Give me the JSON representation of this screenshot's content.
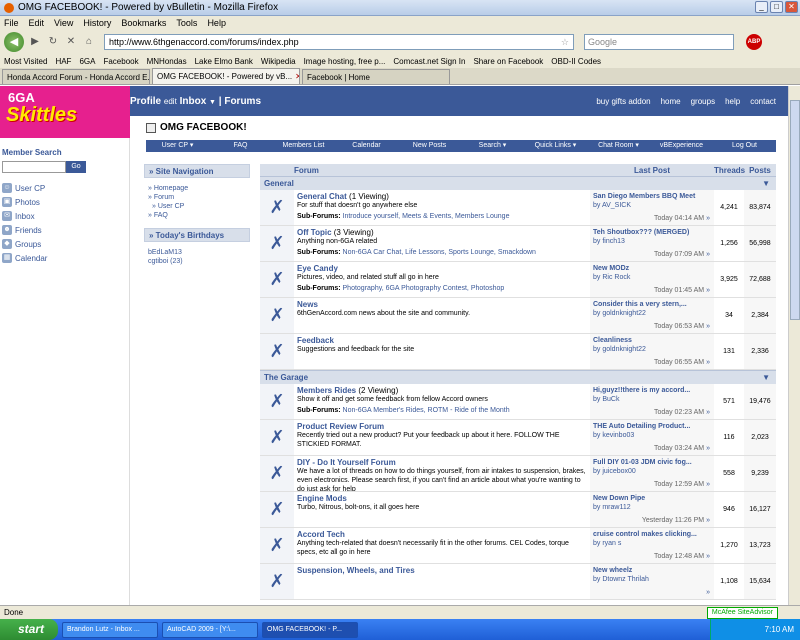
{
  "window": {
    "title": "OMG FACEBOOK! - Powered by vBulletin - Mozilla Firefox"
  },
  "menu": [
    "File",
    "Edit",
    "View",
    "History",
    "Bookmarks",
    "Tools",
    "Help"
  ],
  "url": "http://www.6thgenaccord.com/forums/index.php",
  "search_placeholder": "Google",
  "abp": "ABP",
  "bookmarks": [
    "Most Visited",
    "HAF",
    "6GA",
    "Facebook",
    "MNHondas",
    "Lake Elmo Bank",
    "Wikipedia",
    "Image hosting, free p...",
    "Comcast.net Sign In",
    "Share on Facebook",
    "OBD-II Codes"
  ],
  "tabs": [
    "Honda Accord Forum - Honda Accord E...",
    "OMG FACEBOOK! - Powered by vB...",
    "Facebook | Home"
  ],
  "logo": {
    "line1": "6GA",
    "line2": "Skittles"
  },
  "fbbar": {
    "profile": "Profile",
    "edit": "edit",
    "inbox": "Inbox",
    "forums": "Forums",
    "right": [
      "buy gifts addon",
      "home",
      "groups",
      "help",
      "contact"
    ]
  },
  "member_search": {
    "title": "Member Search",
    "go": "Go"
  },
  "left_nav": [
    "User CP",
    "Photos",
    "Inbox",
    "Friends",
    "Groups",
    "Calendar"
  ],
  "breadcrumb": "OMG FACEBOOK!",
  "forum_nav": [
    "User CP",
    "FAQ",
    "Members List",
    "Calendar",
    "New Posts",
    "Search",
    "Quick Links",
    "Chat Room",
    "vBExperience",
    "Log Out"
  ],
  "site_nav": {
    "title": "Site Navigation",
    "links": [
      "Homepage",
      "Forum",
      "User CP",
      "FAQ"
    ]
  },
  "birthdays": {
    "title": "Today's Birthdays",
    "names": [
      "bEdLaM13",
      "cgtiboi (23)"
    ]
  },
  "forum_head": {
    "forum": "Forum",
    "last_post": "Last Post",
    "threads": "Threads",
    "posts": "Posts"
  },
  "sections": [
    {
      "name": "General",
      "forums": [
        {
          "title": "General Chat",
          "viewing": "(1 Viewing)",
          "desc": "For stuff that doesn't go anywhere else",
          "sub": [
            "Introduce yourself,",
            "Meets & Events,",
            "Members Lounge"
          ],
          "last": "San Diego Members BBQ Meet",
          "by": "by AV_SICK",
          "time": "Today 04:14 AM",
          "threads": "4,241",
          "posts": "83,874"
        },
        {
          "title": "Off Topic",
          "viewing": "(3 Viewing)",
          "desc": "Anything non-6GA related",
          "sub": [
            "Non-6GA Car Chat,",
            "Life Lessons,",
            "Sports Lounge,",
            "Smackdown"
          ],
          "last": "Teh Shoutbox??? (MERGED)",
          "by": "by finch13",
          "time": "Today 07:09 AM",
          "threads": "1,256",
          "posts": "56,998"
        },
        {
          "title": "Eye Candy",
          "viewing": "",
          "desc": "Pictures, video, and related stuff all go in here",
          "sub": [
            "Photography,",
            "6GA Photography Contest,",
            "Photoshop"
          ],
          "last": "New MODz",
          "by": "by Ric Rock",
          "time": "Today 01:45 AM",
          "threads": "3,925",
          "posts": "72,688"
        },
        {
          "title": "News",
          "viewing": "",
          "desc": "6thGenAccord.com news about the site and community.",
          "sub": [],
          "last": "Consider this a very stern,...",
          "by": "by goldnknight22",
          "time": "Today 06:53 AM",
          "threads": "34",
          "posts": "2,384"
        },
        {
          "title": "Feedback",
          "viewing": "",
          "desc": "Suggestions and feedback for the site",
          "sub": [],
          "last": "Cleanliness",
          "by": "by goldnknight22",
          "time": "Today 06:55 AM",
          "threads": "131",
          "posts": "2,336"
        }
      ]
    },
    {
      "name": "The Garage",
      "forums": [
        {
          "title": "Members Rides",
          "viewing": "(2 Viewing)",
          "desc": "Show it off and get some feedback from fellow Accord owners",
          "sub": [
            "Non-6GA Member's Rides,",
            "ROTM - Ride of the Month"
          ],
          "last": "Hi,guyz!!there is my accord...",
          "by": "by BuCk",
          "time": "Today 02:23 AM",
          "threads": "571",
          "posts": "19,476"
        },
        {
          "title": "Product Review Forum",
          "viewing": "",
          "desc": "Recently tried out a new product? Put your feedback up about it here. FOLLOW THE STICKIED FORMAT.",
          "sub": [],
          "last": "THE Auto Detailing Product...",
          "by": "by kevinbo03",
          "time": "Today 03:24 AM",
          "threads": "116",
          "posts": "2,023"
        },
        {
          "title": "DIY - Do It Yourself Forum",
          "viewing": "",
          "desc": "We have a lot of threads on how to do things yourself, from air intakes to suspension, brakes, even electronics. Please search first, if you can't find an article about what you're wanting to do just ask for help",
          "sub": [],
          "last": "Full DIY 01-03 JDM civic fog...",
          "by": "by juicebox00",
          "time": "Today 12:59 AM",
          "threads": "558",
          "posts": "9,239"
        },
        {
          "title": "Engine Mods",
          "viewing": "",
          "desc": "Turbo, Nitrous, bolt-ons, it all goes here",
          "sub": [],
          "last": "New Down Pipe",
          "by": "by mraw112",
          "time": "Yesterday 11:26 PM",
          "threads": "946",
          "posts": "16,127"
        },
        {
          "title": "Accord Tech",
          "viewing": "",
          "desc": "Anything tech-related that doesn't necessarily fit in the other forums. CEL Codes, torque specs, etc all go in here",
          "sub": [],
          "last": "cruise control makes clicking...",
          "by": "by ryan s",
          "time": "Today 12:48 AM",
          "threads": "1,270",
          "posts": "13,723"
        },
        {
          "title": "Suspension, Wheels, and Tires",
          "viewing": "",
          "desc": "",
          "sub": [],
          "last": "New wheelz",
          "by": "by Dtownz Thrilah",
          "time": "",
          "threads": "1,108",
          "posts": "15,634"
        }
      ]
    }
  ],
  "status": {
    "text": "Done",
    "mcafee": "McAfee SiteAdvisor"
  },
  "taskbar": {
    "start": "start",
    "tasks": [
      "Brandon Lutz - Inbox ...",
      "AutoCAD 2009 - [Y:\\...",
      "OMG FACEBOOK! - P..."
    ],
    "clock": "7:10 AM"
  }
}
